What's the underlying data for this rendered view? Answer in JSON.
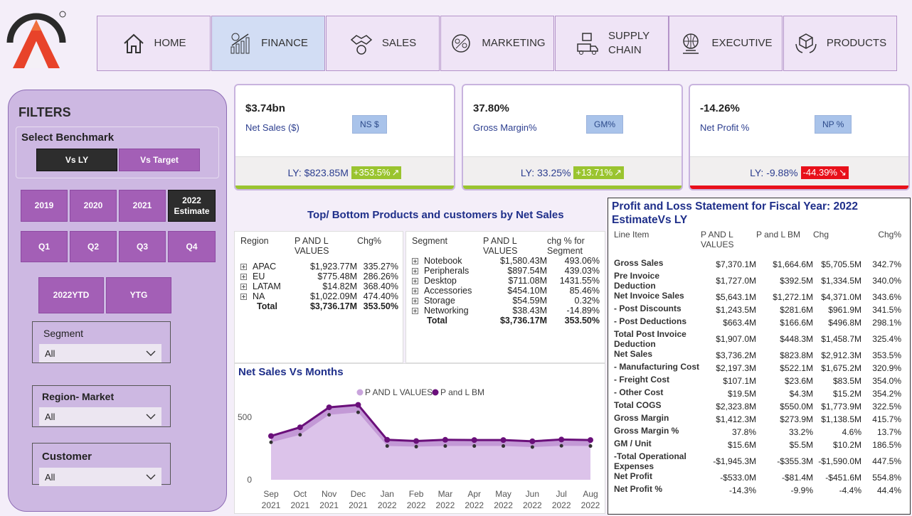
{
  "nav": {
    "items": [
      {
        "label": "HOME",
        "icon": "home-icon"
      },
      {
        "label": "FINANCE",
        "icon": "finance-icon",
        "active": true
      },
      {
        "label": "SALES",
        "icon": "sales-icon"
      },
      {
        "label": "MARKETING",
        "icon": "marketing-icon"
      },
      {
        "label": "SUPPLY CHAIN",
        "icon": "supply-chain-icon"
      },
      {
        "label": "EXECUTIVE",
        "icon": "executive-icon"
      },
      {
        "label": "PRODUCTS",
        "icon": "products-icon"
      }
    ]
  },
  "filters": {
    "title": "FILTERS",
    "benchmark_title": "Select Benchmark",
    "benchmark": [
      "Vs LY",
      "Vs Target"
    ],
    "years": [
      "2019",
      "2020",
      "2021",
      "2022 Estimate"
    ],
    "quarters": [
      "Q1",
      "Q2",
      "Q3",
      "Q4"
    ],
    "periods": [
      "2022YTD",
      "YTG"
    ],
    "segment": {
      "label": "Segment",
      "value": "All"
    },
    "region": {
      "label": "Region- Market",
      "value": "All"
    },
    "customer": {
      "label": "Customer",
      "value": "All"
    }
  },
  "kpis": [
    {
      "value": "$3.74bn",
      "name": "Net Sales ($)",
      "badge": "NS $",
      "ly": "LY: $823.85M",
      "chg": "+353.5%",
      "dir": "pos"
    },
    {
      "value": "37.80%",
      "name": "Gross Margin%",
      "badge": "GM%",
      "ly": "LY: 33.25%",
      "chg": "+13.71%",
      "dir": "pos"
    },
    {
      "value": "-14.26%",
      "name": "Net Profit %",
      "badge": "NP %",
      "ly": "LY: -9.88%",
      "chg": "-44.39%",
      "dir": "neg"
    }
  ],
  "colors": {
    "pos": "#9ac42f",
    "neg": "#e8101a",
    "accent": "#a35fb6",
    "series1": "#c9a4dc",
    "series2": "#6a0f7a"
  },
  "top_bottom_title": "Top/ Bottom Products and customers by Net Sales",
  "region_table": {
    "headers": [
      "Region",
      "P AND L VALUES",
      "Chg%"
    ],
    "rows": [
      [
        "APAC",
        "$1,923.77M",
        "335.27%"
      ],
      [
        "EU",
        "$775.48M",
        "286.26%"
      ],
      [
        "LATAM",
        "$14.82M",
        "368.40%"
      ],
      [
        "NA",
        "$1,022.09M",
        "474.40%"
      ]
    ],
    "total": [
      "Total",
      "$3,736.17M",
      "353.50%"
    ]
  },
  "segment_table": {
    "headers": [
      "Segment",
      "P AND L VALUES",
      "chg % for Segment"
    ],
    "rows": [
      [
        "Notebook",
        "$1,580.43M",
        "493.06%"
      ],
      [
        "Peripherals",
        "$897.54M",
        "439.03%"
      ],
      [
        "Desktop",
        "$711.08M",
        "1431.55%"
      ],
      [
        "Accessories",
        "$454.10M",
        "85.46%"
      ],
      [
        "Storage",
        "$54.59M",
        "0.32%"
      ],
      [
        "Networking",
        "$38.43M",
        "-14.89%"
      ]
    ],
    "total": [
      "Total",
      "$3,736.17M",
      "353.50%"
    ]
  },
  "chart_data": {
    "type": "area",
    "title": "Net Sales Vs Months",
    "categories": [
      "Sep 2021",
      "Oct 2021",
      "Nov 2021",
      "Dec 2021",
      "Jan 2022",
      "Feb 2022",
      "Mar 2022",
      "Apr 2022",
      "May 2022",
      "Jun 2022",
      "Jul 2022",
      "Aug 2022"
    ],
    "series": [
      {
        "name": "P AND L VALUES",
        "values": [
          300,
          360,
          520,
          540,
          270,
          265,
          270,
          270,
          270,
          262,
          272,
          270
        ]
      },
      {
        "name": "P and L BM",
        "values": [
          350,
          420,
          580,
          600,
          320,
          310,
          320,
          318,
          318,
          308,
          322,
          318
        ]
      }
    ],
    "ylim": [
      0,
      700
    ],
    "yticks": [
      0,
      500
    ],
    "legend": "top-center",
    "grid": false
  },
  "pl": {
    "title": "Profit and Loss Statement for Fiscal Year: 2022 EstimateVs LY",
    "headers": [
      "Line Item",
      "P AND L VALUES",
      "P and L BM",
      "Chg",
      "Chg%"
    ],
    "rows": [
      [
        "Gross Sales",
        "$7,370.1M",
        "$1,664.6M",
        "$5,705.5M",
        "342.7%"
      ],
      [
        "Pre Invoice Deduction",
        "$1,727.0M",
        "$392.5M",
        "$1,334.5M",
        "340.0%"
      ],
      [
        "Net Invoice Sales",
        "$5,643.1M",
        "$1,272.1M",
        "$4,371.0M",
        "343.6%"
      ],
      [
        "- Post Discounts",
        "$1,243.5M",
        "$281.6M",
        "$961.9M",
        "341.5%"
      ],
      [
        "- Post Deductions",
        "$663.4M",
        "$166.6M",
        "$496.8M",
        "298.1%"
      ],
      [
        "Total Post Invoice Deduction",
        "$1,907.0M",
        "$448.3M",
        "$1,458.7M",
        "325.4%"
      ],
      [
        "Net Sales",
        "$3,736.2M",
        "$823.8M",
        "$2,912.3M",
        "353.5%"
      ],
      [
        "- Manufacturing Cost",
        "$2,197.3M",
        "$522.1M",
        "$1,675.2M",
        "320.9%"
      ],
      [
        "- Freight Cost",
        "$107.1M",
        "$23.6M",
        "$83.5M",
        "354.0%"
      ],
      [
        "- Other Cost",
        "$19.5M",
        "$4.3M",
        "$15.2M",
        "354.2%"
      ],
      [
        "Total COGS",
        "$2,323.8M",
        "$550.0M",
        "$1,773.9M",
        "322.5%"
      ],
      [
        "Gross Margin",
        "$1,412.3M",
        "$273.9M",
        "$1,138.5M",
        "415.7%"
      ],
      [
        "Gross Margin %",
        "37.8%",
        "33.2%",
        "4.6%",
        "13.7%"
      ],
      [
        "GM / Unit",
        "$15.6M",
        "$5.5M",
        "$10.2M",
        "186.5%"
      ],
      [
        "-Total Operational Expenses",
        "-$1,945.3M",
        "-$355.3M",
        "-$1,590.0M",
        "447.5%"
      ],
      [
        "Net Profit",
        "-$533.0M",
        "-$81.4M",
        "-$451.6M",
        "554.8%"
      ],
      [
        "Net Profit %",
        "-14.3%",
        "-9.9%",
        "-4.4%",
        "44.4%"
      ]
    ]
  }
}
